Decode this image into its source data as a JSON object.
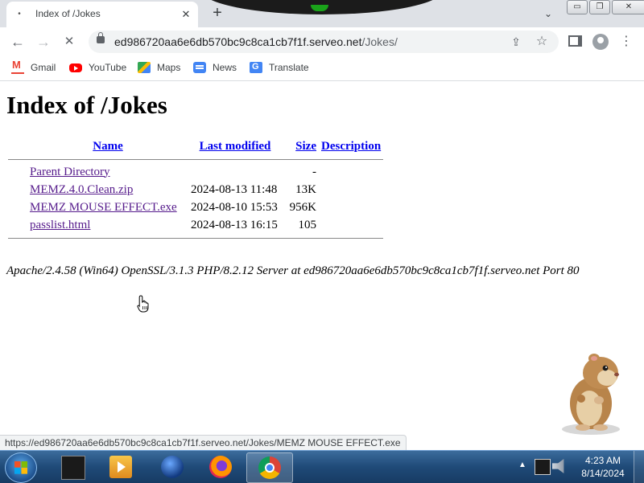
{
  "browser": {
    "tab": {
      "title": "Index of /Jokes",
      "close_glyph": "✕"
    },
    "new_tab_glyph": "+",
    "window_buttons": {
      "minimize": "▭",
      "maximize": "❐",
      "close": "✕"
    },
    "toolbar": {
      "back_glyph": "←",
      "forward_glyph": "→",
      "stop_glyph": "✕",
      "url_host": "ed986720aa6e6db570bc9c8ca1cb7f1f.serveo.net",
      "url_path": "/Jokes/",
      "menu_glyph": "⋮"
    },
    "bookmarks": [
      {
        "label": "Gmail",
        "icon": "gmail-icon"
      },
      {
        "label": "YouTube",
        "icon": "youtube-icon"
      },
      {
        "label": "Maps",
        "icon": "maps-icon"
      },
      {
        "label": "News",
        "icon": "news-icon"
      },
      {
        "label": "Translate",
        "icon": "translate-icon"
      }
    ],
    "status_url": "https://ed986720aa6e6db570bc9c8ca1cb7f1f.serveo.net/Jokes/MEMZ MOUSE EFFECT.exe"
  },
  "page": {
    "heading": "Index of /Jokes",
    "columns": {
      "name": "Name",
      "modified": "Last modified",
      "size": "Size",
      "description": "Description"
    },
    "rows": [
      {
        "name": "Parent Directory",
        "modified": "",
        "size": "-",
        "description": ""
      },
      {
        "name": "MEMZ.4.0.Clean.zip",
        "modified": "2024-08-13 11:48",
        "size": "13K",
        "description": ""
      },
      {
        "name": "MEMZ MOUSE EFFECT.exe",
        "modified": "2024-08-10 15:53",
        "size": "956K",
        "description": ""
      },
      {
        "name": "passlist.html",
        "modified": "2024-08-13 16:15",
        "size": "105",
        "description": ""
      }
    ],
    "server_signature": "Apache/2.4.58 (Win64) OpenSSL/3.1.3 PHP/8.2.12 Server at ed986720aa6e6db570bc9c8ca1cb7f1f.serveo.net Port 80"
  },
  "taskbar": {
    "apps": [
      "terminal-icon",
      "media-player-icon",
      "sphere-app-icon",
      "firefox-icon",
      "chrome-icon"
    ],
    "active_app": "chrome-icon",
    "clock": {
      "time": "4:23 AM",
      "date": "8/14/2024"
    }
  }
}
